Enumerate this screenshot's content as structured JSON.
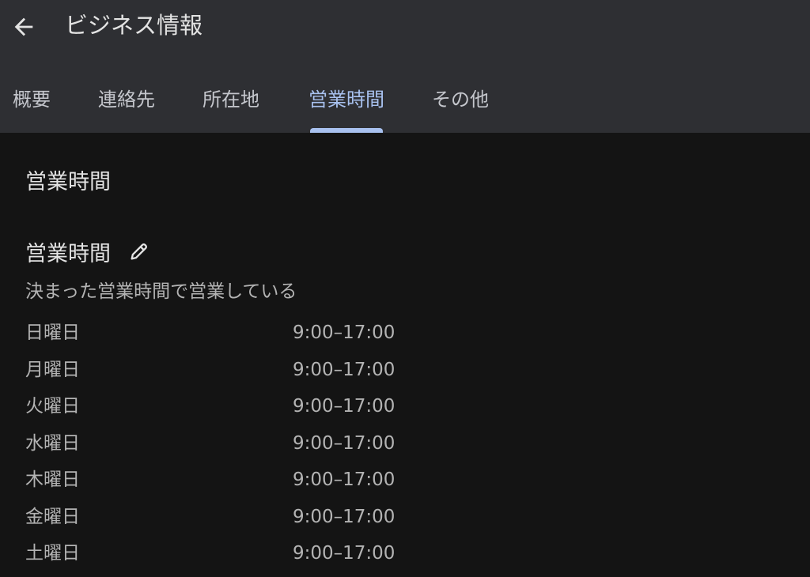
{
  "header": {
    "back_icon": "arrow-back-icon",
    "title": "ビジネス情報"
  },
  "tabs": [
    {
      "label": "概要",
      "active": false
    },
    {
      "label": "連絡先",
      "active": false
    },
    {
      "label": "所在地",
      "active": false
    },
    {
      "label": "営業時間",
      "active": true
    },
    {
      "label": "その他",
      "active": false
    }
  ],
  "section": {
    "title": "営業時間",
    "subheader": "営業時間",
    "edit_icon": "pencil-icon",
    "status": "決まった営業時間で営業している"
  },
  "hours": [
    {
      "day": "日曜日",
      "time": "9:00–17:00"
    },
    {
      "day": "月曜日",
      "time": "9:00–17:00"
    },
    {
      "day": "火曜日",
      "time": "9:00–17:00"
    },
    {
      "day": "水曜日",
      "time": "9:00–17:00"
    },
    {
      "day": "木曜日",
      "time": "9:00–17:00"
    },
    {
      "day": "金曜日",
      "time": "9:00–17:00"
    },
    {
      "day": "土曜日",
      "time": "9:00–17:00"
    }
  ],
  "colors": {
    "app_bar": "#2e2f33",
    "background": "#141414",
    "accent": "#a8c1ef",
    "primary_text": "#e3e3e3",
    "secondary_text": "#b3b3b3"
  }
}
